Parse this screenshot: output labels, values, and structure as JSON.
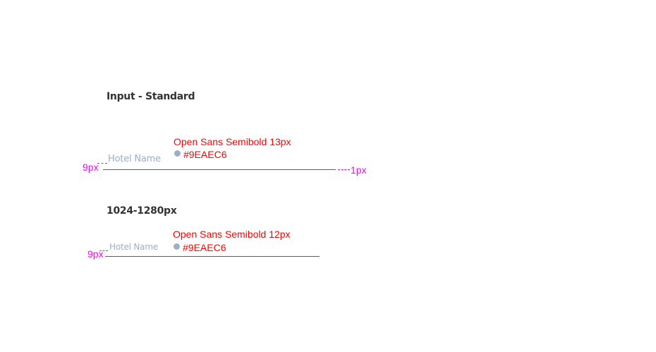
{
  "section_standard": {
    "heading": "Input - Standard",
    "input": {
      "placeholder": "Hotel Name"
    },
    "spec": {
      "font": "Open Sans Semibold 13px",
      "color_label": "#9EAEC6"
    },
    "offset_label": "9px",
    "border_label": "1px"
  },
  "section_small": {
    "heading": "1024-1280px",
    "input": {
      "placeholder": "Hotel Name"
    },
    "spec": {
      "font": "Open Sans Semibold 12px",
      "color_label": "#9EAEC6"
    },
    "offset_label": "9px"
  },
  "colors": {
    "placeholder": "#9EAEC6",
    "annotation": "#ff0000",
    "measure": "#ff00ff",
    "heading": "#333333",
    "underline": "#5a5f69"
  }
}
